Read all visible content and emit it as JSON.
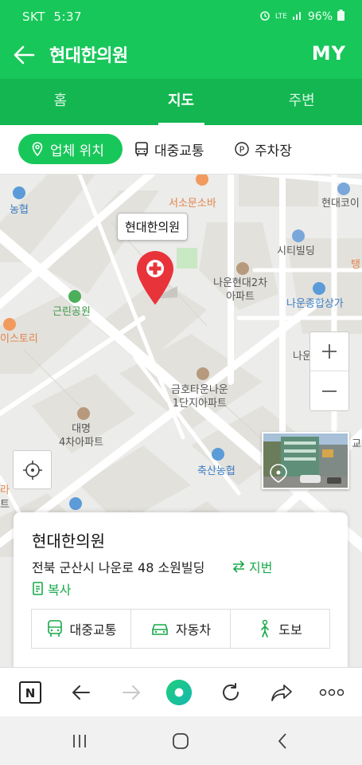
{
  "status_bar": {
    "carrier": "SKT",
    "time": "5:37",
    "network": "LTE",
    "battery": "96%"
  },
  "header": {
    "title": "현대한의원",
    "my_label": "MY"
  },
  "tabs": [
    {
      "label": "홈",
      "active": false
    },
    {
      "label": "지도",
      "active": true
    },
    {
      "label": "주변",
      "active": false
    }
  ],
  "filters": {
    "location": "업체 위치",
    "transit": "대중교통",
    "parking": "주차장"
  },
  "map": {
    "place_tag": "현대한의원",
    "labels": {
      "nonghyup": "농협",
      "seosomun": "서소문소바",
      "hyundaicoin": "현대코이",
      "city_building": "시티빌딩",
      "tang": "탱",
      "naun_hyundai": "나운현대2차",
      "apt": "아파트",
      "geunrin_park": "근린공원",
      "naun_mall": "나운종합상가",
      "story": "이스토리",
      "naun_cut": "나운",
      "geumho_1": "금호타운나운",
      "geumho_2": "1단지아파트",
      "daemyung_1": "대명",
      "daemyung_2": "4차아파트",
      "chuksan": "축산농협",
      "gyo": "교",
      "left_ra": "라",
      "left_teu": "트"
    },
    "colors": {
      "road": "#ffffff",
      "block": "#e3e1dc",
      "park": "#c9e8c4",
      "pin": "#e8333b"
    }
  },
  "card": {
    "name": "현대한의원",
    "address": "전북 군산시 나운로 48 소원빌딩",
    "lot_label": "지번",
    "copy_label": "복사",
    "directions": [
      {
        "label": "대중교통",
        "icon": "bus-icon"
      },
      {
        "label": "자동차",
        "icon": "car-icon"
      },
      {
        "label": "도보",
        "icon": "walk-icon"
      }
    ]
  },
  "colors": {
    "accent": "#18c75a",
    "tabs_bg": "#13b651",
    "link": "#18a84a"
  }
}
